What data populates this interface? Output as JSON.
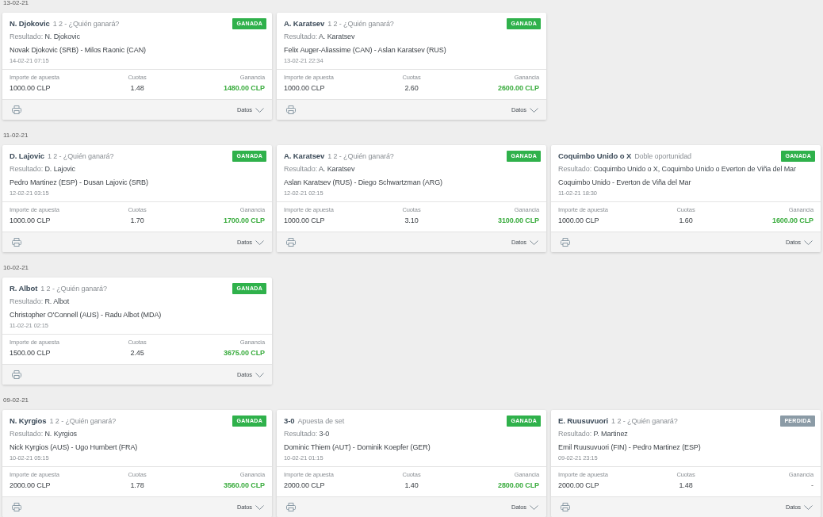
{
  "sections": [
    {
      "date": "13-02-21",
      "bets": [
        {
          "selection": "N. Djokovic",
          "market": "1 2 - ¿Quién ganará?",
          "won": true,
          "status_label": "GANADA",
          "result_label": "Resultado:",
          "result": "N. Djokovic",
          "event": "Novak Djokovic (SRB) - Milos Raonic (CAN)",
          "start": "14-02-21 07:15",
          "stake_label": "Importe de apuesta",
          "stake": "1000.00 CLP",
          "odds_label": "Cuotas",
          "odds": "1.48",
          "winnings_label": "Ganancia",
          "winnings": "1480.00 CLP",
          "details_label": "Datos"
        },
        {
          "selection": "A. Karatsev",
          "market": "1 2 - ¿Quién ganará?",
          "won": true,
          "status_label": "GANADA",
          "result_label": "Resultado:",
          "result": "A. Karatsev",
          "event": "Felix Auger-Aliassime (CAN) - Aslan Karatsev (RUS)",
          "start": "13-02-21 22:34",
          "stake_label": "Importe de apuesta",
          "stake": "1000.00 CLP",
          "odds_label": "Cuotas",
          "odds": "2.60",
          "winnings_label": "Ganancia",
          "winnings": "2600.00 CLP",
          "details_label": "Datos"
        }
      ]
    },
    {
      "date": "11-02-21",
      "bets": [
        {
          "selection": "D. Lajovic",
          "market": "1 2 - ¿Quién ganará?",
          "won": true,
          "status_label": "GANADA",
          "result_label": "Resultado:",
          "result": "D. Lajovic",
          "event": "Pedro Martinez (ESP) - Dusan Lajovic (SRB)",
          "start": "12-02-21 03:15",
          "stake_label": "Importe de apuesta",
          "stake": "1000.00 CLP",
          "odds_label": "Cuotas",
          "odds": "1.70",
          "winnings_label": "Ganancia",
          "winnings": "1700.00 CLP",
          "details_label": "Datos"
        },
        {
          "selection": "A. Karatsev",
          "market": "1 2 - ¿Quién ganará?",
          "won": true,
          "status_label": "GANADA",
          "result_label": "Resultado:",
          "result": "A. Karatsev",
          "event": "Aslan Karatsev (RUS) - Diego Schwartzman (ARG)",
          "start": "12-02-21 02:15",
          "stake_label": "Importe de apuesta",
          "stake": "1000.00 CLP",
          "odds_label": "Cuotas",
          "odds": "3.10",
          "winnings_label": "Ganancia",
          "winnings": "3100.00 CLP",
          "details_label": "Datos"
        },
        {
          "selection": "Coquimbo Unido o X",
          "market": "Doble oportunidad",
          "won": true,
          "status_label": "GANADA",
          "result_label": "Resultado:",
          "result": "Coquimbo Unido o X, Coquimbo Unido o Everton de Viña del Mar",
          "event": "Coquimbo Unido - Everton de Viña del Mar",
          "start": "11-02-21 18:30",
          "stake_label": "Importe de apuesta",
          "stake": "1000.00 CLP",
          "odds_label": "Cuotas",
          "odds": "1.60",
          "winnings_label": "Ganancia",
          "winnings": "1600.00 CLP",
          "details_label": "Datos"
        }
      ]
    },
    {
      "date": "10-02-21",
      "bets": [
        {
          "selection": "R. Albot",
          "market": "1 2 - ¿Quién ganará?",
          "won": true,
          "status_label": "GANADA",
          "result_label": "Resultado:",
          "result": "R. Albot",
          "event": "Christopher O'Connell (AUS) - Radu Albot (MDA)",
          "start": "11-02-21 02:15",
          "stake_label": "Importe de apuesta",
          "stake": "1500.00 CLP",
          "odds_label": "Cuotas",
          "odds": "2.45",
          "winnings_label": "Ganancia",
          "winnings": "3675.00 CLP",
          "details_label": "Datos"
        }
      ]
    },
    {
      "date": "09-02-21",
      "bets": [
        {
          "selection": "N. Kyrgios",
          "market": "1 2 - ¿Quién ganará?",
          "won": true,
          "status_label": "GANADA",
          "result_label": "Resultado:",
          "result": "N. Kyrgios",
          "event": "Nick Kyrgios (AUS) - Ugo Humbert (FRA)",
          "start": "10-02-21 05:15",
          "stake_label": "Importe de apuesta",
          "stake": "2000.00 CLP",
          "odds_label": "Cuotas",
          "odds": "1.78",
          "winnings_label": "Ganancia",
          "winnings": "3560.00 CLP",
          "details_label": "Datos"
        },
        {
          "selection": "3-0",
          "market": "Apuesta de set",
          "won": true,
          "status_label": "GANADA",
          "result_label": "Resultado:",
          "result": "3-0",
          "event": "Dominic Thiem (AUT) - Dominik Koepfer (GER)",
          "start": "10-02-21 01:15",
          "stake_label": "Importe de apuesta",
          "stake": "2000.00 CLP",
          "odds_label": "Cuotas",
          "odds": "1.40",
          "winnings_label": "Ganancia",
          "winnings": "2800.00 CLP",
          "details_label": "Datos"
        },
        {
          "selection": "E. Ruusuvuori",
          "market": "1 2 - ¿Quién ganará?",
          "won": false,
          "status_label": "PERDIDA",
          "result_label": "Resultado:",
          "result": "P. Martinez",
          "event": "Emil Ruusuvuori (FIN) - Pedro Martinez (ESP)",
          "start": "09-02-21 23:15",
          "stake_label": "Importe de apuesta",
          "stake": "2000.00 CLP",
          "odds_label": "Cuotas",
          "odds": "1.48",
          "winnings_label": "Ganancia",
          "winnings": "-",
          "details_label": "Datos"
        }
      ]
    }
  ]
}
